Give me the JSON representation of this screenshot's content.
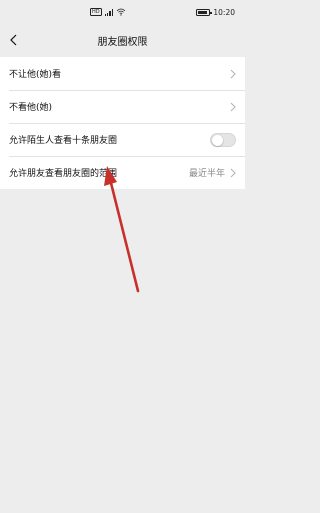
{
  "status_bar": {
    "hd": "HD",
    "network": "4G",
    "time": "10:20",
    "battery_level": 0.85
  },
  "nav": {
    "title": "朋友圈权限"
  },
  "rows": [
    {
      "label": "不让他(她)看"
    },
    {
      "label": "不看他(她)"
    },
    {
      "label": "允许陌生人查看十条朋友圈",
      "toggle_on": false
    },
    {
      "label": "允许朋友查看朋友圈的范围",
      "value": "最近半年"
    }
  ],
  "colors": {
    "background": "#ededed",
    "annotation_arrow": "#c8302b"
  }
}
